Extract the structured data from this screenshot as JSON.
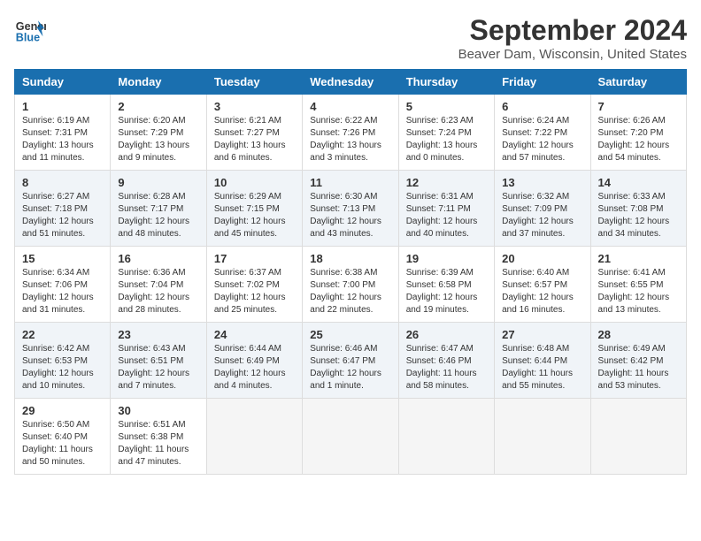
{
  "header": {
    "logo_line1": "General",
    "logo_line2": "Blue",
    "title": "September 2024",
    "subtitle": "Beaver Dam, Wisconsin, United States"
  },
  "columns": [
    "Sunday",
    "Monday",
    "Tuesday",
    "Wednesday",
    "Thursday",
    "Friday",
    "Saturday"
  ],
  "weeks": [
    [
      {
        "day": "1",
        "info": "Sunrise: 6:19 AM\nSunset: 7:31 PM\nDaylight: 13 hours\nand 11 minutes."
      },
      {
        "day": "2",
        "info": "Sunrise: 6:20 AM\nSunset: 7:29 PM\nDaylight: 13 hours\nand 9 minutes."
      },
      {
        "day": "3",
        "info": "Sunrise: 6:21 AM\nSunset: 7:27 PM\nDaylight: 13 hours\nand 6 minutes."
      },
      {
        "day": "4",
        "info": "Sunrise: 6:22 AM\nSunset: 7:26 PM\nDaylight: 13 hours\nand 3 minutes."
      },
      {
        "day": "5",
        "info": "Sunrise: 6:23 AM\nSunset: 7:24 PM\nDaylight: 13 hours\nand 0 minutes."
      },
      {
        "day": "6",
        "info": "Sunrise: 6:24 AM\nSunset: 7:22 PM\nDaylight: 12 hours\nand 57 minutes."
      },
      {
        "day": "7",
        "info": "Sunrise: 6:26 AM\nSunset: 7:20 PM\nDaylight: 12 hours\nand 54 minutes."
      }
    ],
    [
      {
        "day": "8",
        "info": "Sunrise: 6:27 AM\nSunset: 7:18 PM\nDaylight: 12 hours\nand 51 minutes."
      },
      {
        "day": "9",
        "info": "Sunrise: 6:28 AM\nSunset: 7:17 PM\nDaylight: 12 hours\nand 48 minutes."
      },
      {
        "day": "10",
        "info": "Sunrise: 6:29 AM\nSunset: 7:15 PM\nDaylight: 12 hours\nand 45 minutes."
      },
      {
        "day": "11",
        "info": "Sunrise: 6:30 AM\nSunset: 7:13 PM\nDaylight: 12 hours\nand 43 minutes."
      },
      {
        "day": "12",
        "info": "Sunrise: 6:31 AM\nSunset: 7:11 PM\nDaylight: 12 hours\nand 40 minutes."
      },
      {
        "day": "13",
        "info": "Sunrise: 6:32 AM\nSunset: 7:09 PM\nDaylight: 12 hours\nand 37 minutes."
      },
      {
        "day": "14",
        "info": "Sunrise: 6:33 AM\nSunset: 7:08 PM\nDaylight: 12 hours\nand 34 minutes."
      }
    ],
    [
      {
        "day": "15",
        "info": "Sunrise: 6:34 AM\nSunset: 7:06 PM\nDaylight: 12 hours\nand 31 minutes."
      },
      {
        "day": "16",
        "info": "Sunrise: 6:36 AM\nSunset: 7:04 PM\nDaylight: 12 hours\nand 28 minutes."
      },
      {
        "day": "17",
        "info": "Sunrise: 6:37 AM\nSunset: 7:02 PM\nDaylight: 12 hours\nand 25 minutes."
      },
      {
        "day": "18",
        "info": "Sunrise: 6:38 AM\nSunset: 7:00 PM\nDaylight: 12 hours\nand 22 minutes."
      },
      {
        "day": "19",
        "info": "Sunrise: 6:39 AM\nSunset: 6:58 PM\nDaylight: 12 hours\nand 19 minutes."
      },
      {
        "day": "20",
        "info": "Sunrise: 6:40 AM\nSunset: 6:57 PM\nDaylight: 12 hours\nand 16 minutes."
      },
      {
        "day": "21",
        "info": "Sunrise: 6:41 AM\nSunset: 6:55 PM\nDaylight: 12 hours\nand 13 minutes."
      }
    ],
    [
      {
        "day": "22",
        "info": "Sunrise: 6:42 AM\nSunset: 6:53 PM\nDaylight: 12 hours\nand 10 minutes."
      },
      {
        "day": "23",
        "info": "Sunrise: 6:43 AM\nSunset: 6:51 PM\nDaylight: 12 hours\nand 7 minutes."
      },
      {
        "day": "24",
        "info": "Sunrise: 6:44 AM\nSunset: 6:49 PM\nDaylight: 12 hours\nand 4 minutes."
      },
      {
        "day": "25",
        "info": "Sunrise: 6:46 AM\nSunset: 6:47 PM\nDaylight: 12 hours\nand 1 minute."
      },
      {
        "day": "26",
        "info": "Sunrise: 6:47 AM\nSunset: 6:46 PM\nDaylight: 11 hours\nand 58 minutes."
      },
      {
        "day": "27",
        "info": "Sunrise: 6:48 AM\nSunset: 6:44 PM\nDaylight: 11 hours\nand 55 minutes."
      },
      {
        "day": "28",
        "info": "Sunrise: 6:49 AM\nSunset: 6:42 PM\nDaylight: 11 hours\nand 53 minutes."
      }
    ],
    [
      {
        "day": "29",
        "info": "Sunrise: 6:50 AM\nSunset: 6:40 PM\nDaylight: 11 hours\nand 50 minutes."
      },
      {
        "day": "30",
        "info": "Sunrise: 6:51 AM\nSunset: 6:38 PM\nDaylight: 11 hours\nand 47 minutes."
      },
      {
        "day": "",
        "info": ""
      },
      {
        "day": "",
        "info": ""
      },
      {
        "day": "",
        "info": ""
      },
      {
        "day": "",
        "info": ""
      },
      {
        "day": "",
        "info": ""
      }
    ]
  ]
}
